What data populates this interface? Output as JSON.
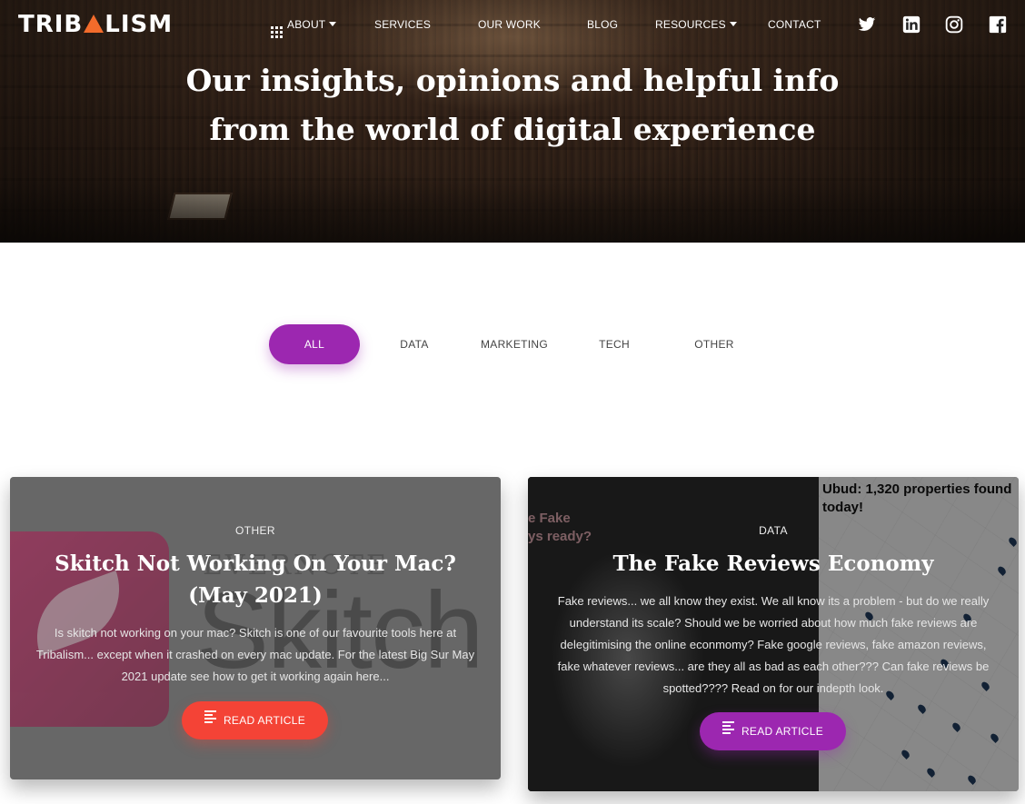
{
  "brand": {
    "logo_left": "TRIB",
    "logo_right": "LISM",
    "accent": "#f26b2b"
  },
  "nav": {
    "items": [
      {
        "label": "ABOUT",
        "has_menu": true,
        "icon": "grid-icon"
      },
      {
        "label": "SERVICES"
      },
      {
        "label": "OUR WORK"
      },
      {
        "label": "BLOG"
      },
      {
        "label": "RESOURCES",
        "has_menu": true
      },
      {
        "label": "CONTACT"
      }
    ],
    "social": [
      "twitter-icon",
      "linkedin-icon",
      "instagram-icon",
      "facebook-icon"
    ]
  },
  "hero": {
    "title_line1": "Our insights, opinions and helpful info",
    "title_line2": "from the world of digital experience"
  },
  "filters": {
    "items": [
      "ALL",
      "DATA",
      "MARKETING",
      "TECH",
      "OTHER"
    ],
    "active": "ALL",
    "active_color": "#9c27b0"
  },
  "cards": [
    {
      "category": "OTHER",
      "title": "Skitch Not Working On Your Mac? (May 2021)",
      "description": "Is skitch not working on your mac? Skitch is one of our favourite tools here at Tribalism... except when it crashed on every mac update. For the latest Big Sur May 2021 update see how to get it working again here...",
      "button": "READ ARTICLE",
      "button_color": "#f44336",
      "image_text_top": "EVERNOTE",
      "image_text_word": "Skitch"
    },
    {
      "category": "DATA",
      "title": "The Fake Reviews Economy",
      "description": "Fake reviews... we all know they exist. We all know its a problem - but do we really understand its scale? Should we be worried about how much fake reviews are delegitimising the online econmomy? Fake google reviews, fake amazon reviews, fake whatever reviews... are they all as bad as each other??? Can fake reviews be spotted???? Read on for our indepth look.",
      "button": "READ ARTICLE",
      "button_color": "#9c27b0",
      "image_text_left": "e Fake\nys ready?",
      "image_text_map": "Ubud: 1,320 properties found\ntoday!"
    }
  ]
}
